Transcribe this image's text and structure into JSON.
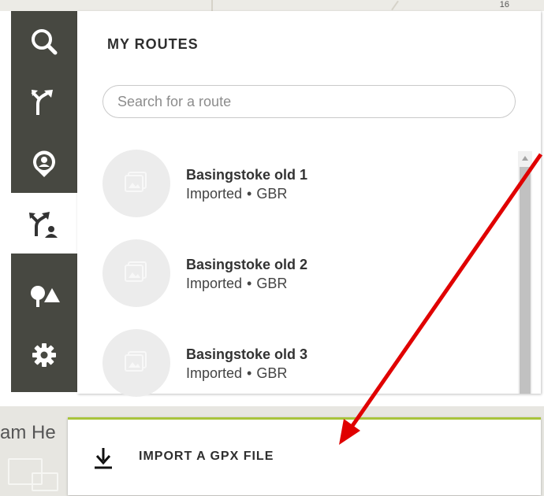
{
  "map": {
    "top_mark": "16",
    "bottom_label": "am He"
  },
  "nav": {
    "items": [
      {
        "icon": "search-icon",
        "active": false
      },
      {
        "icon": "route-plan-icon",
        "active": false
      },
      {
        "icon": "location-pin-icon",
        "active": false
      },
      {
        "icon": "my-routes-icon",
        "active": true
      },
      {
        "icon": "landscape-icon",
        "active": false
      },
      {
        "icon": "settings-gear-icon",
        "active": false
      }
    ]
  },
  "panel": {
    "title": "MY ROUTES",
    "search_placeholder": "Search for a route",
    "routes": [
      {
        "name": "Basingstoke old 1",
        "source": "Imported",
        "separator": "•",
        "country": "GBR"
      },
      {
        "name": "Basingstoke old 2",
        "source": "Imported",
        "separator": "•",
        "country": "GBR"
      },
      {
        "name": "Basingstoke old 3",
        "source": "Imported",
        "separator": "•",
        "country": "GBR"
      }
    ]
  },
  "import": {
    "label": "IMPORT A GPX FILE"
  },
  "colors": {
    "rail": "#474841",
    "accent_line": "#a8c43c",
    "annotation_arrow": "#e00000"
  }
}
